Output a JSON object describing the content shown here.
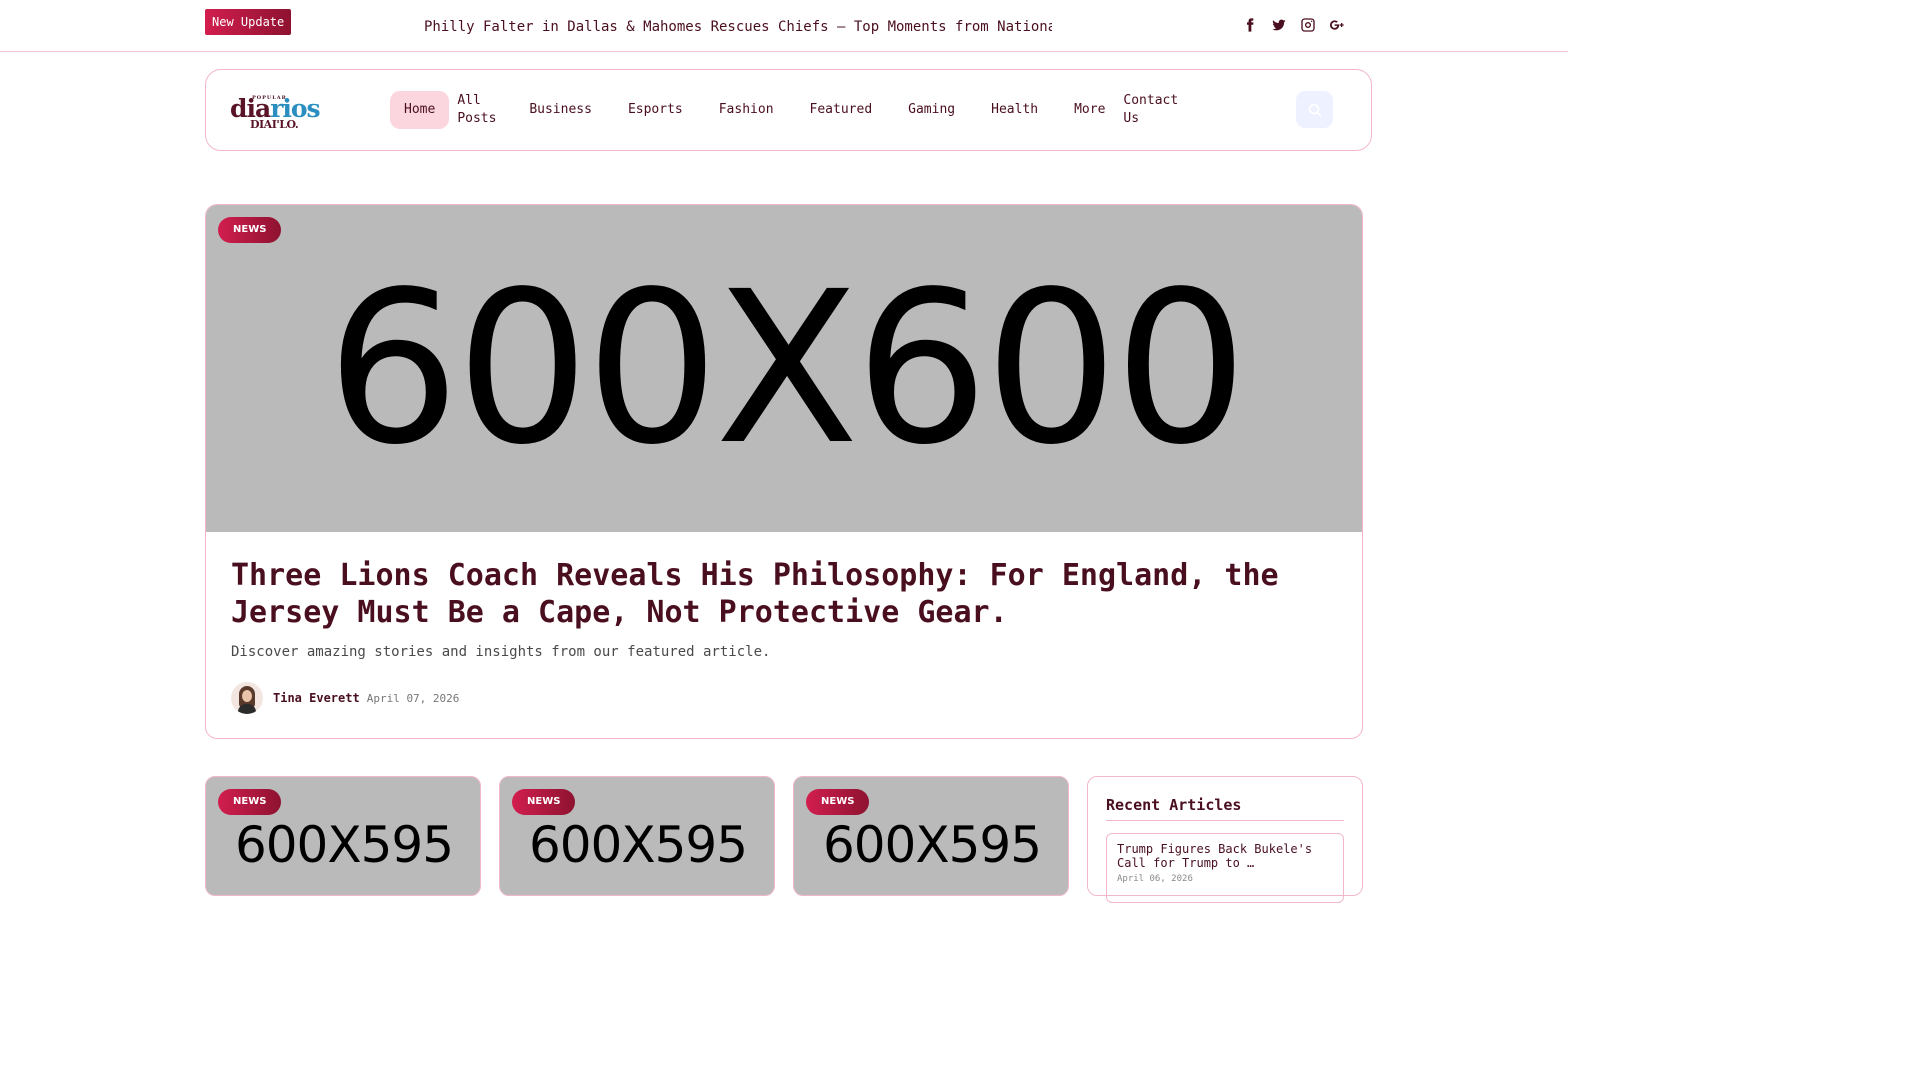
{
  "topbar": {
    "update_label": "New Update",
    "ticker": "Philly Falter in Dallas & Mahomes Rescues Chiefs – Top Moments from National Football League",
    "socials": [
      "facebook-icon",
      "twitter-icon",
      "instagram-icon",
      "google-plus-icon"
    ]
  },
  "logo": {
    "top": "POPULAR",
    "word_a": "dia",
    "word_b": "rios",
    "sub": "DIAI'LO."
  },
  "nav": {
    "items": [
      "Home",
      "All Posts",
      "Business",
      "Esports",
      "Fashion",
      "Featured",
      "Gaming",
      "Health",
      "More",
      "Contact Us"
    ],
    "active": "Home"
  },
  "hero": {
    "tag": "NEWS",
    "image_label": "600X600",
    "title": "Three Lions Coach Reveals His Philosophy: For England, the Jersey Must Be a Cape, Not Protective Gear.",
    "description": "Discover amazing stories and insights from our featured article.",
    "author": "Tina Everett",
    "date": "April 07, 2026"
  },
  "cards": [
    {
      "tag": "NEWS",
      "image_label": "600X595"
    },
    {
      "tag": "NEWS",
      "image_label": "600X595"
    },
    {
      "tag": "NEWS",
      "image_label": "600X595"
    }
  ],
  "sidebar": {
    "title": "Recent Articles",
    "items": [
      {
        "title": "Trump Figures Back Bukele's Call for Trump to …",
        "date": "April 06, 2026"
      }
    ]
  },
  "colors": {
    "accent": "#d21e4f",
    "accent_dark": "#8e1230",
    "text": "#4a0f1f",
    "border": "#f2b8c8"
  }
}
